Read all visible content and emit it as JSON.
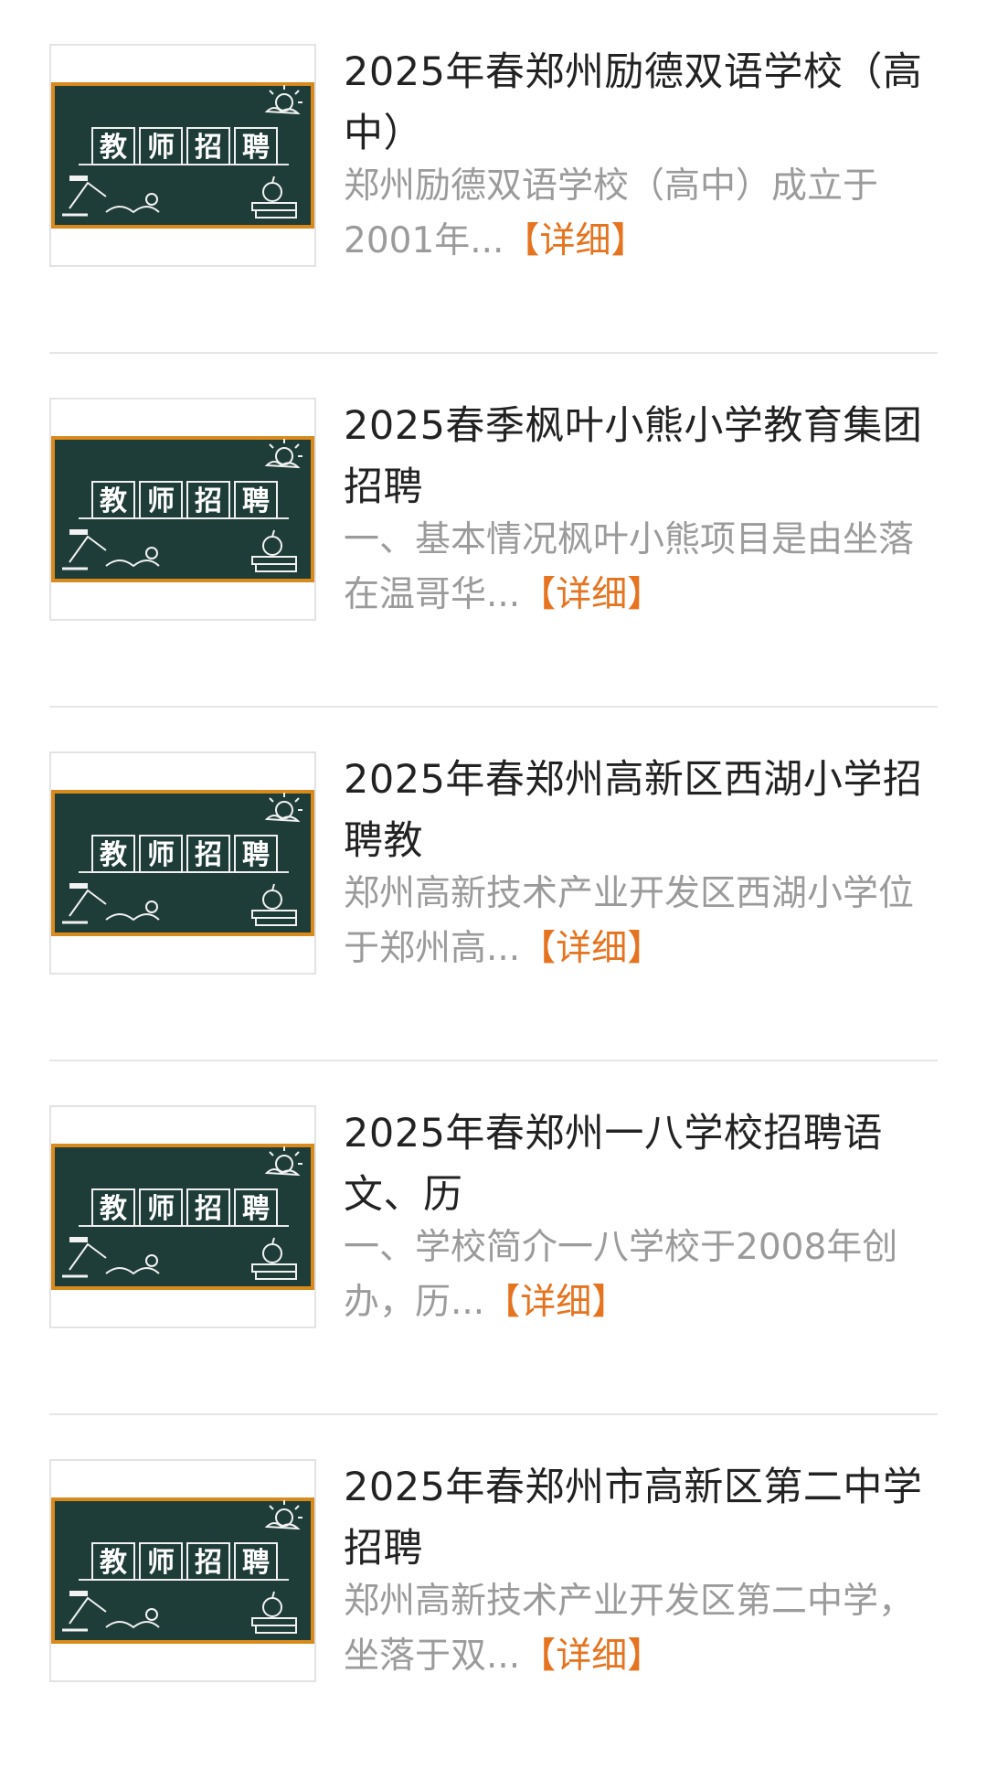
{
  "colors": {
    "title": "#222222",
    "summary": "#9b9b9b",
    "more_link": "#e6731f",
    "chalkboard": "#1f3d38",
    "chalkboard_frame": "#d98a1c",
    "divider": "#e6e6e6"
  },
  "thumbnail": {
    "icon": "teacher-recruitment-chalkboard",
    "chars": [
      "教",
      "师",
      "招",
      "聘"
    ]
  },
  "items": [
    {
      "title": "2025年春郑州励德双语学校（高中）",
      "summary": "郑州励德双语学校（高中）成立于2001年...",
      "more": "【详细】"
    },
    {
      "title": "2025春季枫叶小熊小学教育集团招聘",
      "summary": "一、基本情况枫叶小熊项目是由坐落在温哥华...",
      "more": "【详细】"
    },
    {
      "title": "2025年春郑州高新区西湖小学招聘教",
      "summary": "郑州高新技术产业开发区西湖小学位于郑州高...",
      "more": "【详细】"
    },
    {
      "title": "2025年春郑州一八学校招聘语文、历",
      "summary": "一、学校简介一八学校于2008年创办，历...",
      "more": "【详细】"
    },
    {
      "title": "2025年春郑州市高新区第二中学招聘",
      "summary": "郑州高新技术产业开发区第二中学，坐落于双...",
      "more": "【详细】"
    }
  ]
}
